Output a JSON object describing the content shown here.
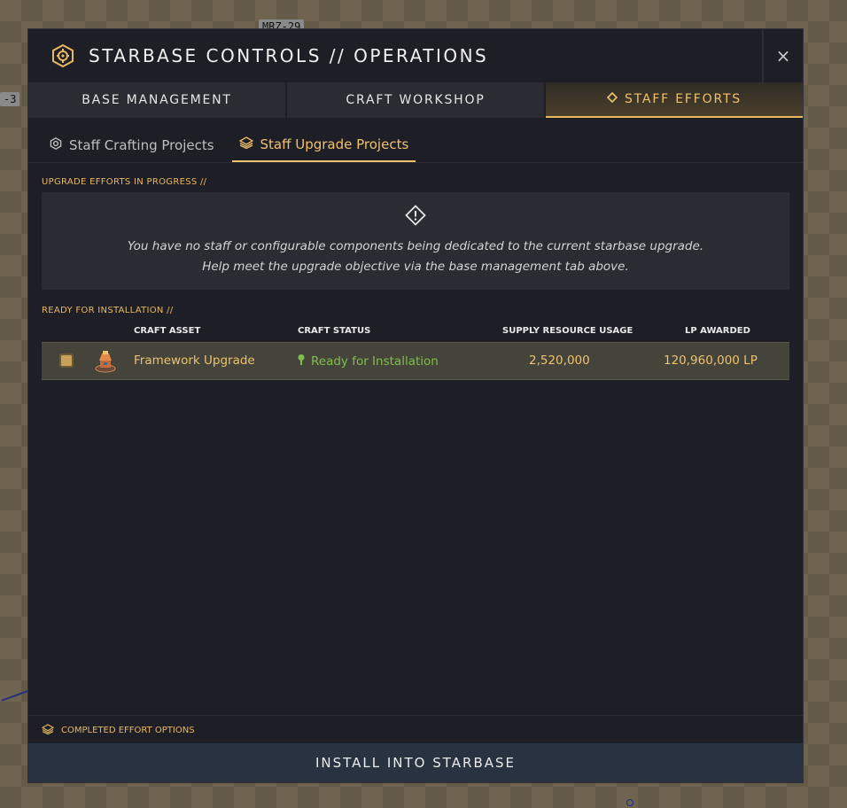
{
  "map": {
    "top_label": "MRZ-29",
    "left_label": "-3"
  },
  "header": {
    "title": "STARBASE CONTROLS // OPERATIONS",
    "icon": "starbase-gear-icon",
    "close": "×"
  },
  "tabs": [
    {
      "label": "BASE MANAGEMENT",
      "active": false
    },
    {
      "label": "CRAFT WORKSHOP",
      "active": false
    },
    {
      "label": "STAFF EFFORTS",
      "active": true,
      "icon": "diamond-icon"
    }
  ],
  "subtabs": [
    {
      "label": "Staff Crafting Projects",
      "icon": "gear-icon",
      "active": false
    },
    {
      "label": "Staff Upgrade Projects",
      "icon": "layers-icon",
      "active": true
    }
  ],
  "upgrade": {
    "label": "UPGRADE EFFORTS IN PROGRESS //",
    "message_line1": "You have no staff or configurable components being dedicated to the current starbase upgrade.",
    "message_line2": "Help meet the upgrade objective via the base management tab above."
  },
  "ready": {
    "label": "READY FOR INSTALLATION //",
    "columns": {
      "asset": "CRAFT ASSET",
      "status": "CRAFT STATUS",
      "supply": "SUPPLY RESOURCE USAGE",
      "lp": "LP AWARDED"
    },
    "rows": [
      {
        "asset": "Framework Upgrade",
        "status": "Ready for Installation",
        "supply": "2,520,000",
        "lp": "120,960,000 LP",
        "checked": true
      }
    ]
  },
  "footer": {
    "options_label": "COMPLETED EFFORT OPTIONS",
    "install_button": "INSTALL INTO STARBASE"
  },
  "colors": {
    "accent": "#f0c16d",
    "status_ok": "#7fbf4d",
    "panel": "#1e1f26",
    "button": "#283240"
  }
}
